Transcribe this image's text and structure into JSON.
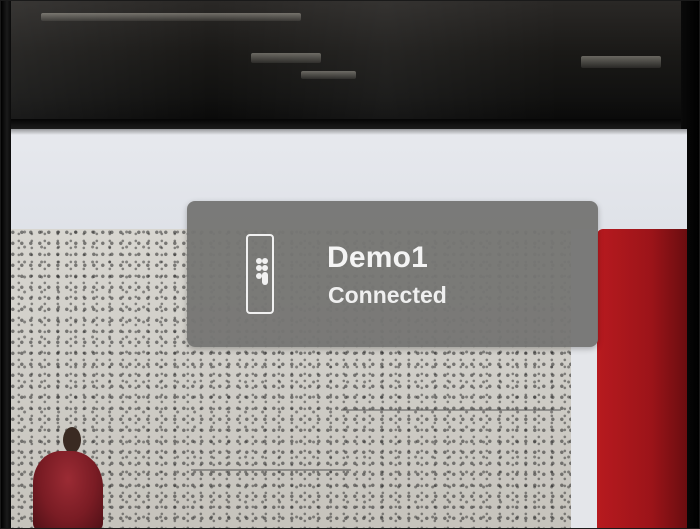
{
  "notification": {
    "icon": "remote-icon",
    "device_name": "Demo1",
    "status": "Connected"
  },
  "colors": {
    "banner_background": "#767674",
    "banner_text": "#f4f4f4",
    "screen_background": "#e4e6ea",
    "red_tile": "#b71a1f",
    "bezel": "#111110"
  }
}
